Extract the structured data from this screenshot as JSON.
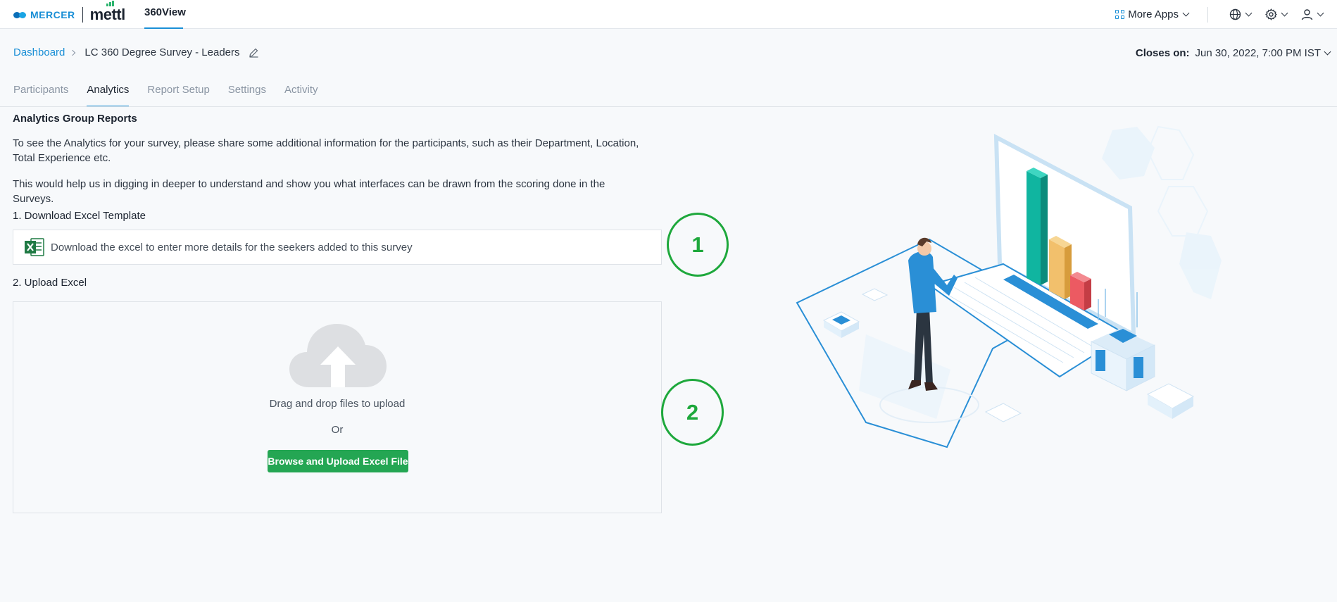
{
  "topbar": {
    "brand_mercer": "MERCER",
    "brand_mettl": "mettl",
    "app_tab": "360View",
    "more_apps": "More Apps",
    "icons": [
      "globe-icon",
      "gear-icon",
      "user-icon"
    ]
  },
  "header": {
    "breadcrumb_root": "Dashboard",
    "breadcrumb_current": "LC 360 Degree Survey - Leaders",
    "closes_label": "Closes on:",
    "closes_value": "Jun 30, 2022, 7:00 PM IST"
  },
  "tabs": [
    {
      "label": "Participants",
      "active": false
    },
    {
      "label": "Analytics",
      "active": true
    },
    {
      "label": "Report Setup",
      "active": false
    },
    {
      "label": "Settings",
      "active": false
    },
    {
      "label": "Activity",
      "active": false
    }
  ],
  "content": {
    "section_title": "Analytics Group Reports",
    "para1": "To see the Analytics for your survey, please share some additional information for the participants, such as their Department, Location, Total Experience etc.",
    "para2": "This would help us in digging in deeper to understand and show you what interfaces can be drawn from the scoring done in the Surveys.",
    "step1_title": "1. Download Excel Template",
    "download_text": "Download the excel to enter more details for the seekers added to this survey",
    "step2_title": "2. Upload Excel",
    "drag_text": "Drag and drop files to upload",
    "or_text": "Or",
    "upload_button": "Browse and Upload Excel File"
  },
  "annotations": {
    "mark1": "1",
    "mark2": "2",
    "color": "#1ea83c"
  },
  "colors": {
    "accent": "#1a8fd6",
    "button": "#24a653"
  }
}
